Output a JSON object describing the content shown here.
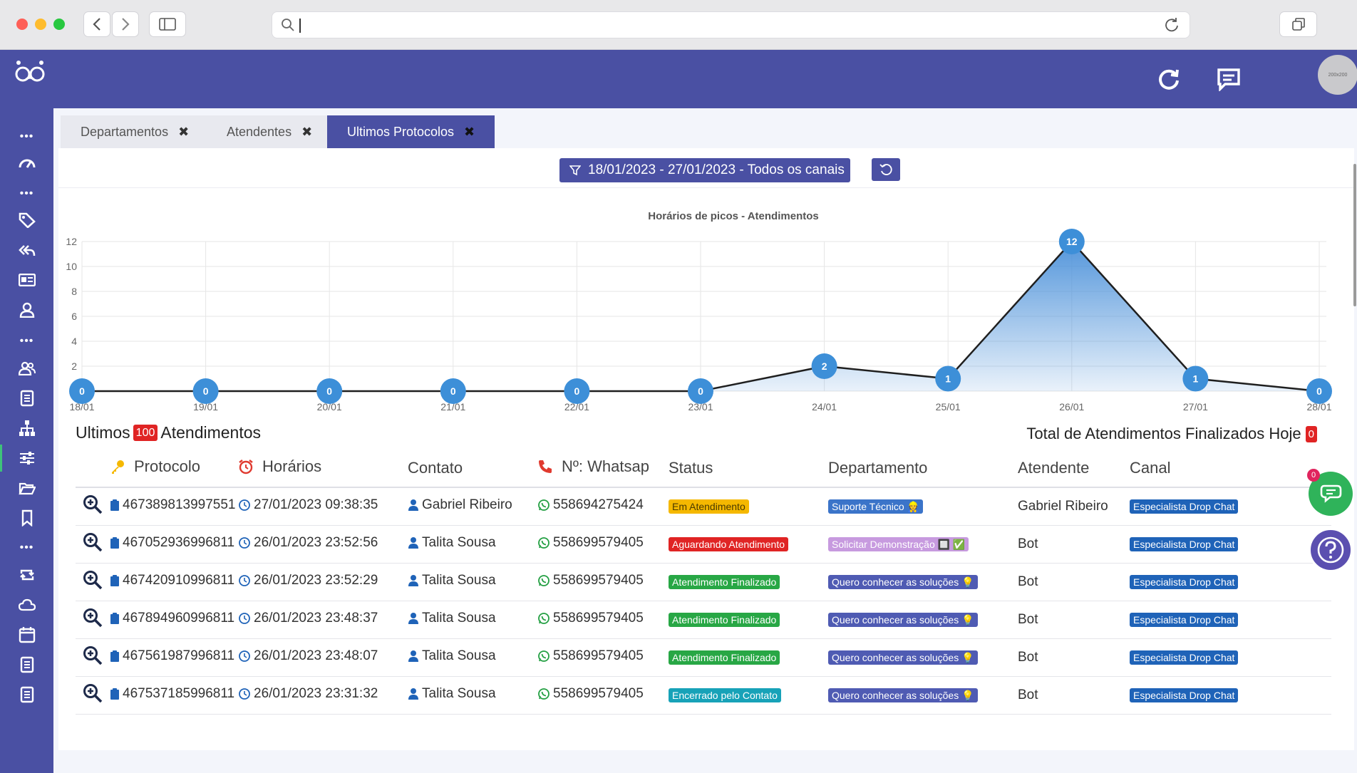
{
  "app": {
    "avatar_text": "200x200"
  },
  "tabs": [
    {
      "label": "Departamentos"
    },
    {
      "label": "Atendentes"
    },
    {
      "label": "Ultimos Protocolos"
    }
  ],
  "filter": {
    "label": "18/01/2023 - 27/01/2023 - Todos os canais"
  },
  "chart_data": {
    "type": "area",
    "title": "Horários de picos - Atendimentos",
    "categories": [
      "18/01",
      "19/01",
      "20/01",
      "21/01",
      "22/01",
      "23/01",
      "24/01",
      "25/01",
      "26/01",
      "27/01",
      "28/01"
    ],
    "values": [
      0,
      0,
      0,
      0,
      0,
      0,
      2,
      1,
      12,
      1,
      0
    ],
    "y_ticks": [
      "0",
      "2",
      "4",
      "6",
      "8",
      "10",
      "12"
    ],
    "ylim": [
      0,
      12
    ],
    "grid": true,
    "line_color": "#1f1f1f",
    "fill_color": "#4a90d9",
    "point_color": "#3d8fd8"
  },
  "table": {
    "title_pre": "Ultimos",
    "count": "100",
    "title_post": "Atendimentos",
    "finalizados_label": "Total de Atendimentos Finalizados Hoje",
    "finalizados_count": "0",
    "headers": [
      "Protocolo",
      "Horários",
      "Contato",
      "Nº: Whatsap",
      "Status",
      "Departamento",
      "Atendente",
      "Canal"
    ],
    "rows": [
      {
        "protocolo": "467389813997551",
        "horario": "27/01/2023 09:38:35",
        "contato": "Gabriel Ribeiro",
        "whatsapp": "558694275424",
        "status": "Em Atendimento",
        "status_color": "yellow",
        "departamento": "Suporte Técnico 👷",
        "dep_color": "blue",
        "atendente": "Gabriel Ribeiro",
        "canal": "Especialista Drop Chat"
      },
      {
        "protocolo": "467052936996811",
        "horario": "26/01/2023 23:52:56",
        "contato": "Talita Sousa",
        "whatsapp": "558699579405",
        "status": "Aguardando Atendimento",
        "status_color": "red",
        "departamento": "Solicitar Demonstração 🔲 ✅",
        "dep_color": "lav",
        "atendente": "Bot",
        "canal": "Especialista Drop Chat"
      },
      {
        "protocolo": "467420910996811",
        "horario": "26/01/2023 23:52:29",
        "contato": "Talita Sousa",
        "whatsapp": "558699579405",
        "status": "Atendimento Finalizado",
        "status_color": "green",
        "departamento": "Quero conhecer as soluções 💡",
        "dep_color": "indigo",
        "atendente": "Bot",
        "canal": "Especialista Drop Chat"
      },
      {
        "protocolo": "467894960996811",
        "horario": "26/01/2023 23:48:37",
        "contato": "Talita Sousa",
        "whatsapp": "558699579405",
        "status": "Atendimento Finalizado",
        "status_color": "green",
        "departamento": "Quero conhecer as soluções 💡",
        "dep_color": "indigo",
        "atendente": "Bot",
        "canal": "Especialista Drop Chat"
      },
      {
        "protocolo": "467561987996811",
        "horario": "26/01/2023 23:48:07",
        "contato": "Talita Sousa",
        "whatsapp": "558699579405",
        "status": "Atendimento Finalizado",
        "status_color": "green",
        "departamento": "Quero conhecer as soluções 💡",
        "dep_color": "indigo",
        "atendente": "Bot",
        "canal": "Especialista Drop Chat"
      },
      {
        "protocolo": "467537185996811",
        "horario": "26/01/2023 23:31:32",
        "contato": "Talita Sousa",
        "whatsapp": "558699579405",
        "status": "Encerrado pelo Contato",
        "status_color": "teal",
        "departamento": "Quero conhecer as soluções 💡",
        "dep_color": "indigo",
        "atendente": "Bot",
        "canal": "Especialista Drop Chat"
      }
    ]
  },
  "chat_widget": {
    "badge": "0"
  }
}
